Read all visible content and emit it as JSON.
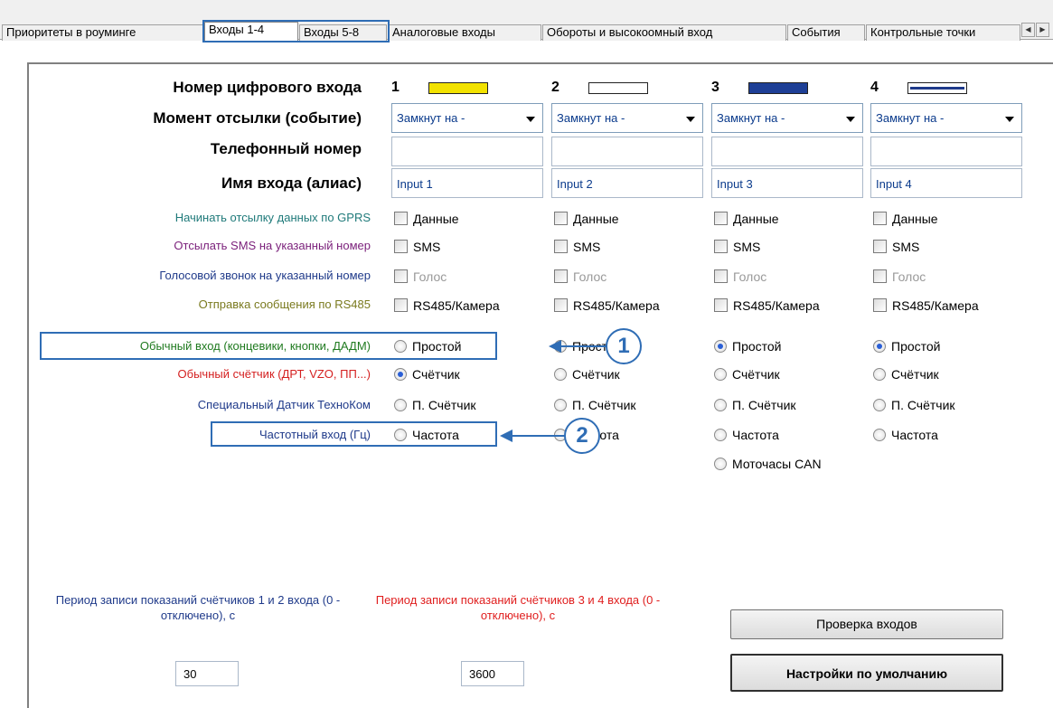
{
  "tabs": [
    {
      "label": "Приоритеты в роуминге"
    },
    {
      "label": "Входы 1-4"
    },
    {
      "label": "Входы 5-8"
    },
    {
      "label": "Аналоговые входы"
    },
    {
      "label": "Обороты и высокоомный вход"
    },
    {
      "label": "События"
    },
    {
      "label": "Контрольные точки"
    }
  ],
  "labels": {
    "input_number": "Номер цифрового входа",
    "send_moment": "Момент отсылки (событие)",
    "phone": "Телефонный номер",
    "alias": "Имя входа (алиас)",
    "gprs": "Начинать отсылку данных по GPRS",
    "sms": "Отсылать SMS на указанный номер",
    "voice": "Голосовой звонок на указанный номер",
    "rs485": "Отправка сообщения по RS485",
    "normal_input": "Обычный вход (концевики, кнопки, ДАДМ)",
    "counter": "Обычный счётчик (ДРТ, VZO, ПП...)",
    "special_sensor": "Специальный Датчик ТехноКом",
    "freq_input": "Частотный вход (Гц)"
  },
  "label_colors": {
    "gprs": "#1f7a7a",
    "sms": "#7a1f7a",
    "voice": "#1f3a8a",
    "rs485": "#7a7a1f",
    "normal_input": "#1f7a1f",
    "counter": "#d42020",
    "special_sensor": "#1f3a8a",
    "freq_input": "#1f3a8a"
  },
  "columns": [
    {
      "num": "1",
      "color": "#f2e200",
      "event": "Замкнут на -",
      "phone": "",
      "alias": "Input 1",
      "data": "Данные",
      "sms": "SMS",
      "voice": "Голос",
      "rs485": "RS485/Камера",
      "radios": [
        "Простой",
        "Счётчик",
        "П. Счётчик",
        "Частота"
      ],
      "selected": "Счётчик"
    },
    {
      "num": "2",
      "color": "#ffffff",
      "event": "Замкнут на -",
      "phone": "",
      "alias": "Input 2",
      "data": "Данные",
      "sms": "SMS",
      "voice": "Голос",
      "rs485": "RS485/Камера",
      "radios": [
        "Простой",
        "Счётчик",
        "П. Счётчик",
        "Частота"
      ],
      "selected": ""
    },
    {
      "num": "3",
      "color": "#1e3f96",
      "event": "Замкнут на -",
      "phone": "",
      "alias": "Input 3",
      "data": "Данные",
      "sms": "SMS",
      "voice": "Голос",
      "rs485": "RS485/Камера",
      "radios": [
        "Простой",
        "Счётчик",
        "П. Счётчик",
        "Частота",
        "Моточасы CAN"
      ],
      "selected": "Простой"
    },
    {
      "num": "4",
      "color": "#ffffff",
      "event": "Замкнут на -",
      "phone": "",
      "alias": "Input 4",
      "data": "Данные",
      "sms": "SMS",
      "voice": "Голос",
      "rs485": "RS485/Камера",
      "radios": [
        "Простой",
        "Счётчик",
        "П. Счётчик",
        "Частота"
      ],
      "selected": "Простой"
    }
  ],
  "callouts": [
    "1",
    "2"
  ],
  "period12": {
    "label": "Период записи показаний счётчиков 1 и 2 входа (0 - отключено), с",
    "value": "30"
  },
  "period34": {
    "label": "Период записи показаний счётчиков 3 и 4 входа (0 - отключено), с",
    "value": "3600"
  },
  "buttons": {
    "check": "Проверка входов",
    "defaults": "Настройки по умолчанию"
  },
  "colors": {
    "highlight": "#2f6db5",
    "period34_text": "#e01e1e",
    "period12_text": "#1f3a8a",
    "field_text": "#0b3b8c"
  }
}
